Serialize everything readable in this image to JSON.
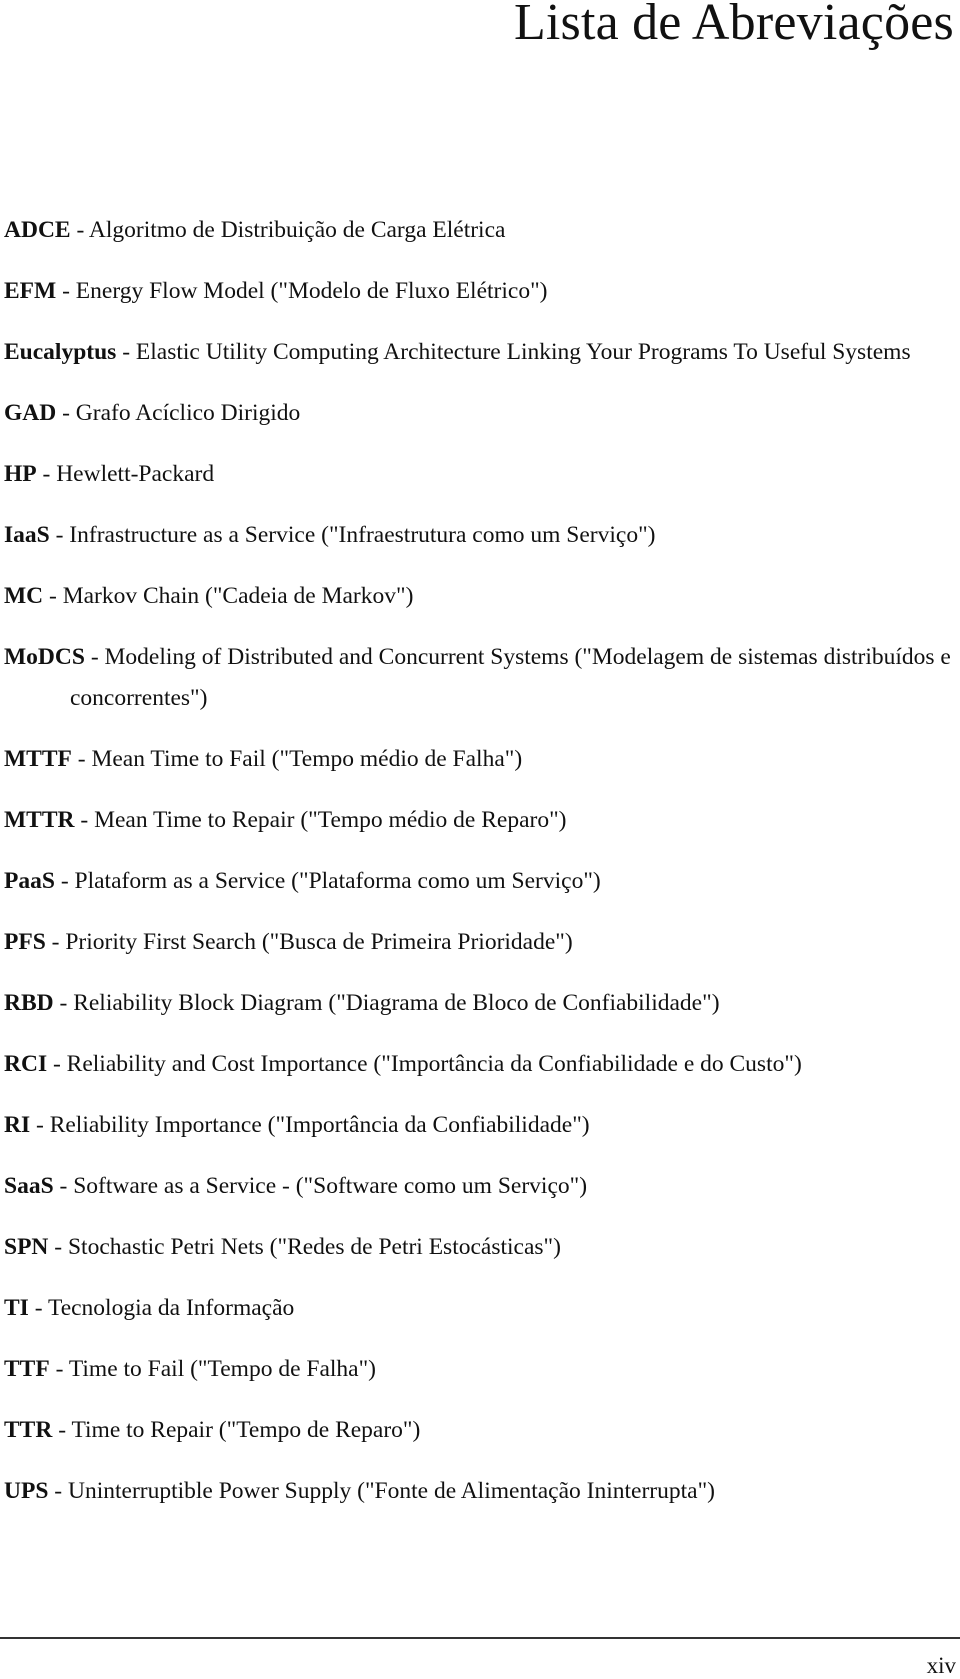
{
  "page": {
    "title": "Lista de Abreviações",
    "page_number": "xiv"
  },
  "abbreviations": [
    {
      "abbr": "ADCE",
      "definition": " - Algoritmo de Distribuição de Carga Elétrica"
    },
    {
      "abbr": "EFM",
      "definition": " - Energy Flow Model (\"Modelo de Fluxo Elétrico\")"
    },
    {
      "abbr": "Eucalyptus",
      "definition": " - Elastic Utility Computing Architecture Linking Your Programs To Useful Systems"
    },
    {
      "abbr": "GAD",
      "definition": " - Grafo Acíclico Dirigido"
    },
    {
      "abbr": "HP",
      "definition": " - Hewlett-Packard"
    },
    {
      "abbr": "IaaS",
      "definition": " - Infrastructure as a Service (\"Infraestrutura como um Serviço\")"
    },
    {
      "abbr": "MC",
      "definition": " - Markov Chain (\"Cadeia de Markov\")"
    },
    {
      "abbr": "MoDCS",
      "definition": " - Modeling of Distributed and Concurrent Systems (\"Modelagem de sistemas distribuídos e concorrentes\")"
    },
    {
      "abbr": "MTTF",
      "definition": " - Mean Time to Fail (\"Tempo médio de Falha\")"
    },
    {
      "abbr": "MTTR",
      "definition": " - Mean Time to Repair (\"Tempo médio de Reparo\")"
    },
    {
      "abbr": "PaaS",
      "definition": " - Plataform as a Service (\"Plataforma como um Serviço\")"
    },
    {
      "abbr": "PFS",
      "definition": " - Priority First Search (\"Busca de Primeira Prioridade\")"
    },
    {
      "abbr": "RBD",
      "definition": " - Reliability Block Diagram (\"Diagrama de Bloco de Confiabilidade\")"
    },
    {
      "abbr": "RCI",
      "definition": " - Reliability and Cost Importance (\"Importância da Confiabilidade e do Custo\")"
    },
    {
      "abbr": "RI",
      "definition": " - Reliability Importance (\"Importância da Confiabilidade\")"
    },
    {
      "abbr": "SaaS",
      "definition": " - Software as a Service - (\"Software como um Serviço\")"
    },
    {
      "abbr": "SPN",
      "definition": " - Stochastic Petri Nets (\"Redes de Petri Estocásticas\")"
    },
    {
      "abbr": "TI",
      "definition": " - Tecnologia da Informação"
    },
    {
      "abbr": "TTF",
      "definition": " - Time to Fail (\"Tempo de Falha\")"
    },
    {
      "abbr": "TTR",
      "definition": " - Time to Repair (\"Tempo de Reparo\")"
    },
    {
      "abbr": "UPS",
      "definition": " - Uninterruptible Power Supply (\"Fonte de Alimentação Ininterrupta\")"
    }
  ]
}
